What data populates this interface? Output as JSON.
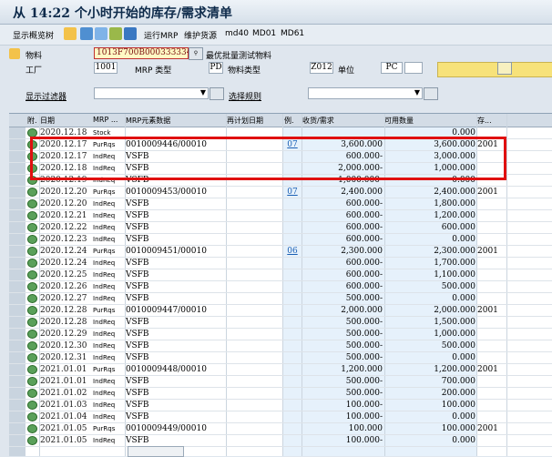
{
  "window": {
    "title": "从 14:22 个小时开始的库存/需求清单"
  },
  "toolbar": {
    "overview_label": "显示概览树",
    "mrp_label": "运行MRP",
    "maintain_label": "维护货源",
    "md40_label": "md40",
    "md01_label": "MD01",
    "md61_label": "MD61"
  },
  "header": {
    "material_label": "物料",
    "material_value": "1013F700B000333334",
    "material_desc": "最优批量测试物料",
    "plant_label": "工厂",
    "plant_value": "1001",
    "mrptype_label": "MRP 类型",
    "mrptype_value": "PD",
    "mattype_label": "物料类型",
    "mattype_value": "Z012",
    "unit_label": "单位",
    "unit_value": "PC",
    "filter_label": "显示过滤器",
    "rule_label": "选择规则"
  },
  "grid": {
    "columns": [
      "附.",
      "日期",
      "MRP ...",
      "MRP元素数据",
      "再计划日期",
      "例.",
      "收货/需求",
      "可用数量",
      "存..."
    ],
    "rows": [
      {
        "date": "2020.12.18",
        "type": "Stock",
        "elem": "",
        "excp": "",
        "qty": "",
        "avail": "0.000",
        "stor": ""
      },
      {
        "date": "2020.12.17",
        "type": "PurRqs",
        "elem": "0010009446/00010",
        "excp": "07",
        "qty": "3,600.000",
        "avail": "3,600.000",
        "stor": "2001"
      },
      {
        "date": "2020.12.17",
        "type": "IndReq",
        "elem": "VSFB",
        "excp": "",
        "qty": "600.000-",
        "avail": "3,000.000",
        "stor": ""
      },
      {
        "date": "2020.12.18",
        "type": "IndReq",
        "elem": "VSFB",
        "excp": "",
        "qty": "2,000.000-",
        "avail": "1,000.000",
        "stor": ""
      },
      {
        "date": "2020.12.19",
        "type": "IndReq",
        "elem": "VSFB",
        "excp": "",
        "qty": "1,000.000-",
        "avail": "0.000",
        "stor": ""
      },
      {
        "date": "2020.12.20",
        "type": "PurRqs",
        "elem": "0010009453/00010",
        "excp": "07",
        "qty": "2,400.000",
        "avail": "2,400.000",
        "stor": "2001"
      },
      {
        "date": "2020.12.20",
        "type": "IndReq",
        "elem": "VSFB",
        "excp": "",
        "qty": "600.000-",
        "avail": "1,800.000",
        "stor": ""
      },
      {
        "date": "2020.12.21",
        "type": "IndReq",
        "elem": "VSFB",
        "excp": "",
        "qty": "600.000-",
        "avail": "1,200.000",
        "stor": ""
      },
      {
        "date": "2020.12.22",
        "type": "IndReq",
        "elem": "VSFB",
        "excp": "",
        "qty": "600.000-",
        "avail": "600.000",
        "stor": ""
      },
      {
        "date": "2020.12.23",
        "type": "IndReq",
        "elem": "VSFB",
        "excp": "",
        "qty": "600.000-",
        "avail": "0.000",
        "stor": ""
      },
      {
        "date": "2020.12.24",
        "type": "PurRqs",
        "elem": "0010009451/00010",
        "excp": "06",
        "qty": "2,300.000",
        "avail": "2,300.000",
        "stor": "2001"
      },
      {
        "date": "2020.12.24",
        "type": "IndReq",
        "elem": "VSFB",
        "excp": "",
        "qty": "600.000-",
        "avail": "1,700.000",
        "stor": ""
      },
      {
        "date": "2020.12.25",
        "type": "IndReq",
        "elem": "VSFB",
        "excp": "",
        "qty": "600.000-",
        "avail": "1,100.000",
        "stor": ""
      },
      {
        "date": "2020.12.26",
        "type": "IndReq",
        "elem": "VSFB",
        "excp": "",
        "qty": "600.000-",
        "avail": "500.000",
        "stor": ""
      },
      {
        "date": "2020.12.27",
        "type": "IndReq",
        "elem": "VSFB",
        "excp": "",
        "qty": "500.000-",
        "avail": "0.000",
        "stor": ""
      },
      {
        "date": "2020.12.28",
        "type": "PurRqs",
        "elem": "0010009447/00010",
        "excp": "",
        "qty": "2,000.000",
        "avail": "2,000.000",
        "stor": "2001"
      },
      {
        "date": "2020.12.28",
        "type": "IndReq",
        "elem": "VSFB",
        "excp": "",
        "qty": "500.000-",
        "avail": "1,500.000",
        "stor": ""
      },
      {
        "date": "2020.12.29",
        "type": "IndReq",
        "elem": "VSFB",
        "excp": "",
        "qty": "500.000-",
        "avail": "1,000.000",
        "stor": ""
      },
      {
        "date": "2020.12.30",
        "type": "IndReq",
        "elem": "VSFB",
        "excp": "",
        "qty": "500.000-",
        "avail": "500.000",
        "stor": ""
      },
      {
        "date": "2020.12.31",
        "type": "IndReq",
        "elem": "VSFB",
        "excp": "",
        "qty": "500.000-",
        "avail": "0.000",
        "stor": ""
      },
      {
        "date": "2021.01.01",
        "type": "PurRqs",
        "elem": "0010009448/00010",
        "excp": "",
        "qty": "1,200.000",
        "avail": "1,200.000",
        "stor": "2001"
      },
      {
        "date": "2021.01.01",
        "type": "IndReq",
        "elem": "VSFB",
        "excp": "",
        "qty": "500.000-",
        "avail": "700.000",
        "stor": ""
      },
      {
        "date": "2021.01.02",
        "type": "IndReq",
        "elem": "VSFB",
        "excp": "",
        "qty": "500.000-",
        "avail": "200.000",
        "stor": ""
      },
      {
        "date": "2021.01.03",
        "type": "IndReq",
        "elem": "VSFB",
        "excp": "",
        "qty": "100.000-",
        "avail": "100.000",
        "stor": ""
      },
      {
        "date": "2021.01.04",
        "type": "IndReq",
        "elem": "VSFB",
        "excp": "",
        "qty": "100.000-",
        "avail": "0.000",
        "stor": ""
      },
      {
        "date": "2021.01.05",
        "type": "PurRqs",
        "elem": "0010009449/00010",
        "excp": "",
        "qty": "100.000",
        "avail": "100.000",
        "stor": "2001"
      },
      {
        "date": "2021.01.05",
        "type": "IndReq",
        "elem": "VSFB",
        "excp": "",
        "qty": "100.000-",
        "avail": "0.000",
        "stor": ""
      }
    ]
  }
}
